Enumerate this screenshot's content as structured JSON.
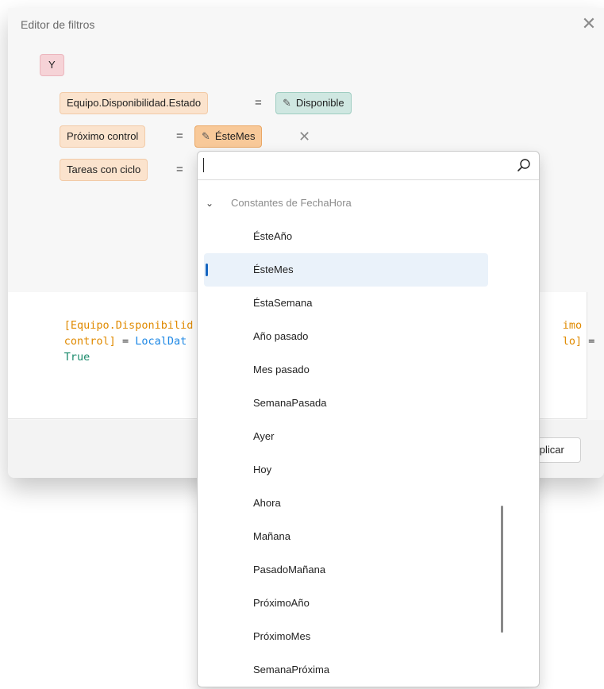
{
  "window": {
    "title": "Editor de filtros"
  },
  "filter": {
    "group_operator": "Y",
    "conditions": [
      {
        "field": "Equipo.Disponibilidad.Estado",
        "operator": "=",
        "value": "Disponible"
      },
      {
        "field": "Próximo control",
        "operator": "=",
        "value": "ÉsteMes"
      },
      {
        "field": "Tareas con ciclo",
        "operator": "="
      }
    ]
  },
  "expression": {
    "line1_field": "[Equipo.Disponibilid",
    "line1_tail": "imo",
    "line2_field_end": "control]",
    "line2_op": " = ",
    "line2_func": "LocalDat",
    "line2_tail_field": "lo]",
    "line2_tail_op": " =",
    "line3_bool": "True"
  },
  "footer": {
    "apply_label": "Aplicar"
  },
  "dropdown": {
    "search_value": "",
    "group_label": "Constantes de FechaHora",
    "items": [
      "ÉsteAño",
      "ÉsteMes",
      "ÉstaSemana",
      "Año pasado",
      "Mes pasado",
      "SemanaPasada",
      "Ayer",
      "Hoy",
      "Ahora",
      "Mañana",
      "PasadoMañana",
      "PróximoAño",
      "PróximoMes",
      "SemanaPróxima"
    ],
    "selected_item": "ÉsteMes"
  },
  "colors": {
    "accent": "#1565c0",
    "field_chip": "#fbe3cd",
    "value_chip": "#cfe7e1",
    "group_chip": "#f6d3d7",
    "field_token": "#e08a00",
    "function_token": "#1e88e5",
    "bool_token": "#1a8a6b"
  }
}
